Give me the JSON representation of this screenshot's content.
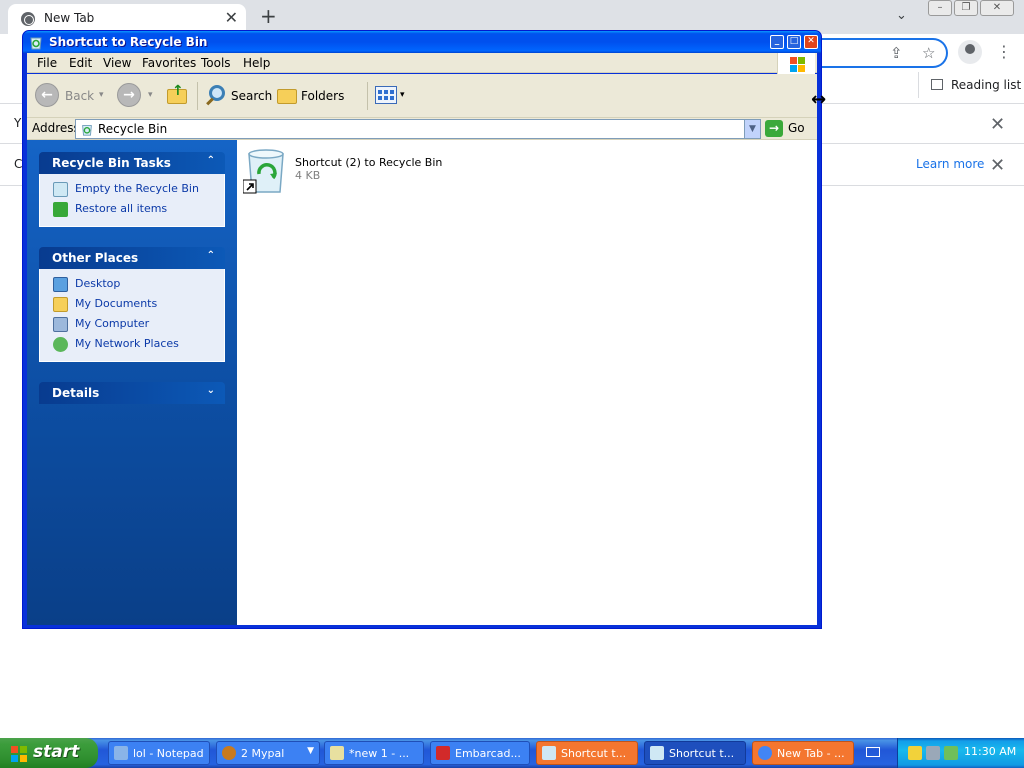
{
  "browser": {
    "tab_title": "New Tab",
    "tab_close": "✕",
    "new_tab": "+",
    "tab_search": "⌄",
    "reading_list": "Reading list",
    "learn_more": "Learn more",
    "bar1_char": "Y",
    "bar2_char": "C",
    "bar_close": "✕",
    "share_icon": "⇪",
    "star_icon": "☆",
    "kebab": "⋮"
  },
  "explorer": {
    "title": "Shortcut to Recycle Bin",
    "menu": [
      "File",
      "Edit",
      "View",
      "Favorites",
      "Tools",
      "Help"
    ],
    "toolbar": {
      "back": "Back",
      "search": "Search",
      "folders": "Folders"
    },
    "address": {
      "label": "Address",
      "value": "Recycle Bin",
      "go": "Go"
    },
    "tasks": {
      "title": "Recycle Bin Tasks",
      "items": [
        "Empty the Recycle Bin",
        "Restore all items"
      ]
    },
    "other_places": {
      "title": "Other Places",
      "items": [
        "Desktop",
        "My Documents",
        "My Computer",
        "My Network Places"
      ]
    },
    "details": {
      "title": "Details"
    },
    "file": {
      "name": "Shortcut (2) to Recycle Bin",
      "size": "4 KB"
    }
  },
  "taskbar": {
    "start": "start",
    "buttons": [
      {
        "label": "lol - Notepad"
      },
      {
        "label": "2 Mypal"
      },
      {
        "label": "*new 1 - ..."
      },
      {
        "label": "Embarcad..."
      },
      {
        "label": "Shortcut t..."
      },
      {
        "label": "Shortcut t..."
      },
      {
        "label": "New Tab - ..."
      }
    ],
    "clock": "11:30 AM"
  },
  "colors": {
    "xp_blue": "#0831d9",
    "taskpane": "#0d4fa5",
    "taskbar": "#2663e0",
    "start_green": "#3c9d3c",
    "flash_orange": "#f4762f",
    "chrome_blue": "#1a73e8"
  }
}
